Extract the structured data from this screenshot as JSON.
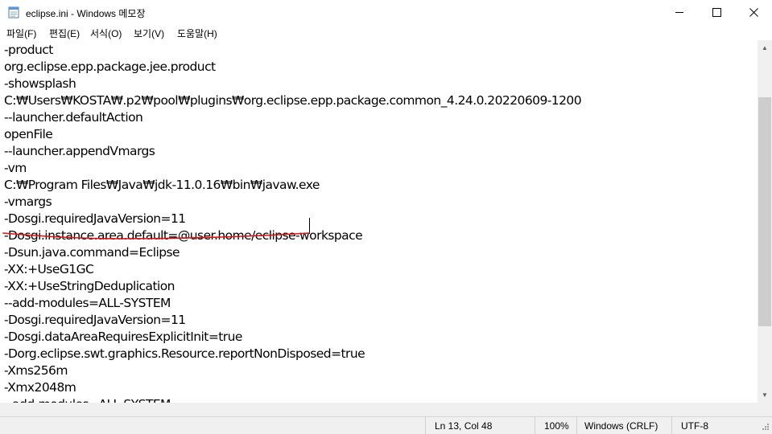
{
  "window": {
    "title": "eclipse.ini - Windows 메모장",
    "minimize_icon": "minimize-icon",
    "maximize_icon": "maximize-icon",
    "close_icon": "close-icon"
  },
  "menu": [
    {
      "label": "파일(F)"
    },
    {
      "label": "편집(E)"
    },
    {
      "label": "서식(O)"
    },
    {
      "label": "보기(V)"
    },
    {
      "label": "도움말(H)"
    }
  ],
  "editor": {
    "lines": [
      "-product",
      "org.eclipse.epp.package.jee.product",
      "-showsplash",
      "C:₩Users₩KOSTA₩.p2₩pool₩plugins₩org.eclipse.epp.package.common_4.24.0.20220609-1200",
      "--launcher.defaultAction",
      "openFile",
      "--launcher.appendVmargs",
      "-vm",
      "C:₩Program Files₩Java₩jdk-11.0.16₩bin₩javaw.exe",
      "-vmargs",
      "-Dosgi.requiredJavaVersion=11",
      "-Dosgi.instance.area.default=@user.home/eclipse-workspace",
      "-Dsun.java.command=Eclipse",
      "-XX:+UseG1GC",
      "-XX:+UseStringDeduplication",
      "--add-modules=ALL-SYSTEM",
      "-Dosgi.requiredJavaVersion=11",
      "-Dosgi.dataAreaRequiresExplicitInit=true",
      "-Dorg.eclipse.swt.graphics.Resource.reportNonDisposed=true",
      "-Xms256m",
      "-Xmx2048m",
      "--add-modules=ALL-SYSTEM"
    ],
    "annotation_color": "#e01010"
  },
  "status": {
    "position": "Ln 13, Col 48",
    "zoom": "100%",
    "line_ending": "Windows (CRLF)",
    "encoding": "UTF-8"
  }
}
